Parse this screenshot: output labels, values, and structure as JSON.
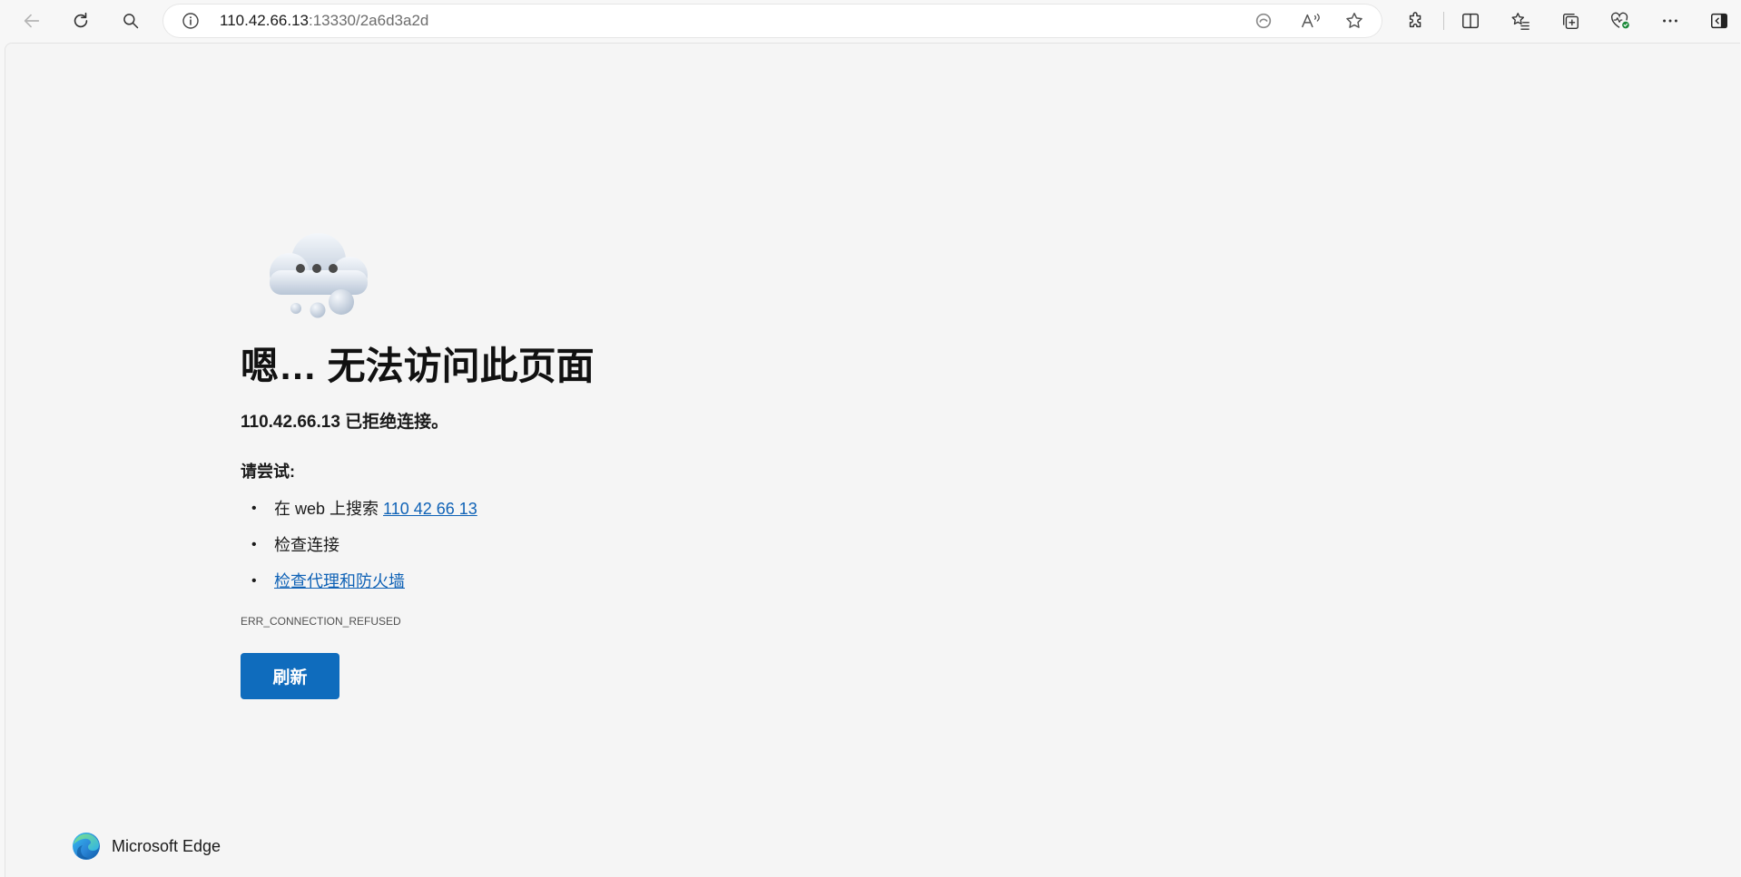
{
  "browser": {
    "address": {
      "host": "110.42.66.13",
      "rest": ":13330/2a6d3a2d"
    },
    "icons": {
      "back": "back-arrow-icon",
      "refresh": "refresh-icon",
      "search": "search-icon",
      "site_info": "info-icon",
      "tracking": "tracking-prevention-icon",
      "read_aloud": "read-aloud-icon",
      "favorite": "star-icon",
      "extensions": "puzzle-icon",
      "split_screen": "split-screen-icon",
      "favorites": "favorites-list-icon",
      "collections": "collections-icon",
      "performance": "heart-pulse-icon",
      "more": "more-dots-icon",
      "sidebar": "sidebar-toggle-icon"
    }
  },
  "error_page": {
    "title": "嗯… 无法访问此页面",
    "subtitle": "110.42.66.13 已拒绝连接。",
    "try_label": "请尝试:",
    "suggestions": [
      {
        "prefix": "在 web 上搜索 ",
        "link": "110 42 66 13"
      },
      {
        "text": "检查连接"
      },
      {
        "link": "检查代理和防火墙"
      }
    ],
    "error_code": "ERR_CONNECTION_REFUSED",
    "refresh_button": "刷新"
  },
  "footer": {
    "brand": "Microsoft Edge"
  }
}
